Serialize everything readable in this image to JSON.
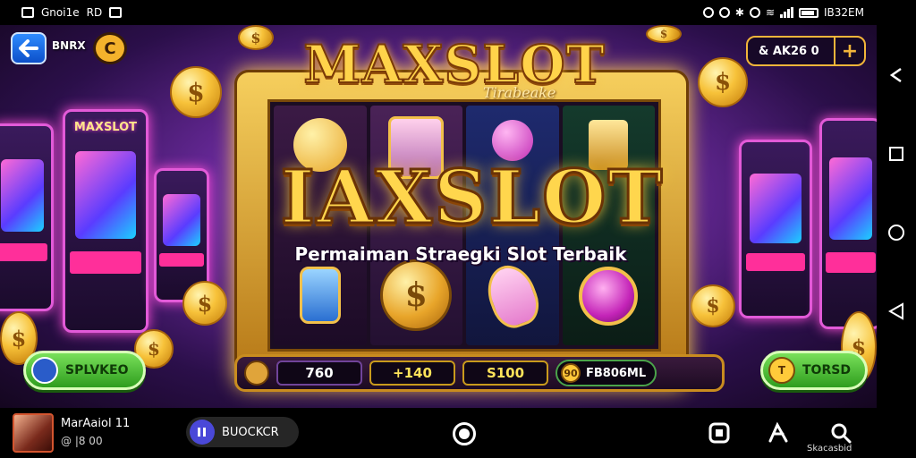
{
  "status_bar": {
    "left_text": "Gnoi1e",
    "left_extra": "RD",
    "right_text": "IB32EM"
  },
  "game": {
    "back_label": "Back",
    "player_tag": "BNRX",
    "rank_symbol": "C",
    "balance": "& AK26 0",
    "balance_plus": "+",
    "logo": "MAXSLOT",
    "logo_sub": "Tirabeake",
    "cabinet_label": "MAXSLOT",
    "title": "IAXSLOT",
    "tagline": "Permaiman Straegki Slot Terbaik",
    "bet_values": [
      "760",
      "+140",
      "S100"
    ],
    "bet_pill_coin": "90",
    "bet_pill_label": "FB806ML",
    "left_button": "SPLVKEO",
    "right_button": "TORSD",
    "right_button_coin": "T"
  },
  "bottom_bar": {
    "profile_name": "MarAaiol 11",
    "profile_sub": "@ |8 00",
    "brand_label": "BUOCKCR",
    "search_label": "Skacasbid"
  },
  "colors": {
    "gold": "#ffd34a",
    "purple": "#6a2a9c",
    "green": "#4aa34a",
    "blue": "#2f8cff"
  }
}
